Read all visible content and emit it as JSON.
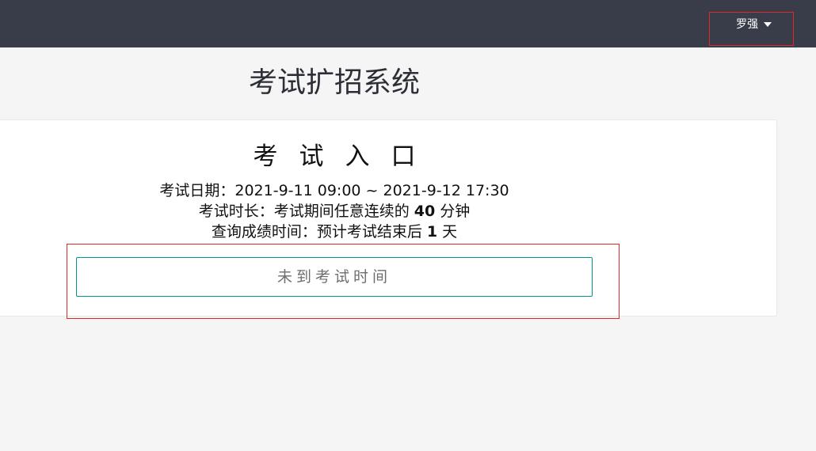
{
  "header": {
    "user_name": "罗强",
    "user_menu_icon": "caret-down-icon"
  },
  "page": {
    "title": "考试扩招系统"
  },
  "exam": {
    "entry_title": "考试入口",
    "date_label": "考试日期：",
    "date_value": "2021-9-11 09:00 ~ 2021-9-12 17:30",
    "duration_label": "考试时长：考试期间任意连续的 ",
    "duration_value": "40",
    "duration_unit": " 分钟",
    "result_label": "查询成绩时间：预计考试结束后 ",
    "result_value": "1",
    "result_unit": " 天",
    "status_button": "未到考试时间"
  },
  "colors": {
    "topbar": "#393d49",
    "button_border": "#009688",
    "highlight": "#e02a2a"
  }
}
